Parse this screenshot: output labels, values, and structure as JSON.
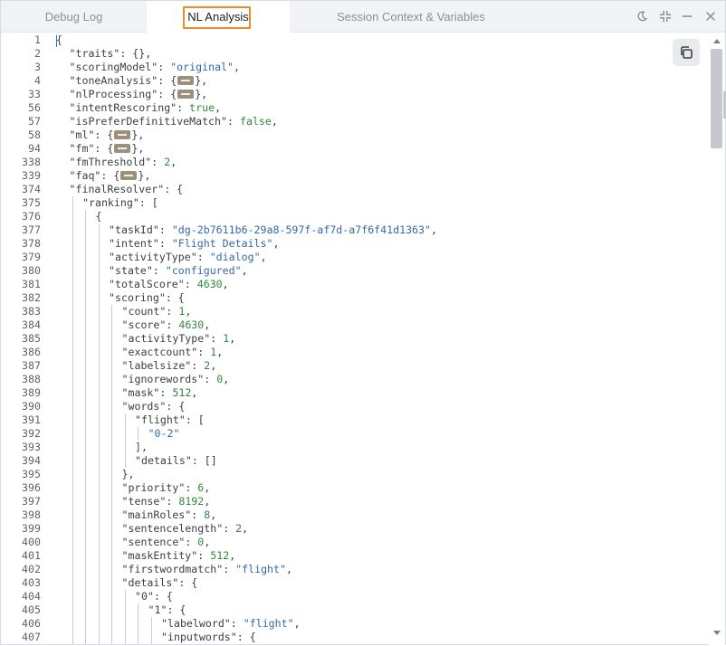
{
  "tabs": [
    {
      "label": "Debug Log",
      "active": false
    },
    {
      "label": "NL Analysis",
      "active": true
    },
    {
      "label": "Session Context & Variables",
      "active": false
    }
  ],
  "window_controls": [
    "moon-icon",
    "collapse-icon",
    "minimize-icon",
    "close-icon"
  ],
  "colors": {
    "highlight": "#f08b2c",
    "string": "#3668a8",
    "number": "#2e8b3a"
  },
  "lines": [
    {
      "n": "1",
      "d": 0,
      "t": [
        [
          "p",
          "{"
        ]
      ]
    },
    {
      "n": "2",
      "d": 1,
      "t": [
        [
          "k",
          "\"traits\""
        ],
        [
          "p",
          ": {},"
        ]
      ]
    },
    {
      "n": "3",
      "d": 1,
      "t": [
        [
          "k",
          "\"scoringModel\""
        ],
        [
          "p",
          ": "
        ],
        [
          "s",
          "\"original\""
        ],
        [
          "p",
          ","
        ]
      ]
    },
    {
      "n": "4",
      "d": 1,
      "t": [
        [
          "k",
          "\"toneAnalysis\""
        ],
        [
          "p",
          ": {"
        ],
        [
          "f",
          ""
        ],
        [
          "p",
          "},"
        ]
      ]
    },
    {
      "n": "33",
      "d": 1,
      "t": [
        [
          "k",
          "\"nlProcessing\""
        ],
        [
          "p",
          ": {"
        ],
        [
          "f",
          ""
        ],
        [
          "p",
          "},"
        ]
      ]
    },
    {
      "n": "56",
      "d": 1,
      "t": [
        [
          "k",
          "\"intentRescoring\""
        ],
        [
          "p",
          ": "
        ],
        [
          "b",
          "true"
        ],
        [
          "p",
          ","
        ]
      ]
    },
    {
      "n": "57",
      "d": 1,
      "t": [
        [
          "k",
          "\"isPreferDefinitiveMatch\""
        ],
        [
          "p",
          ": "
        ],
        [
          "b",
          "false"
        ],
        [
          "p",
          ","
        ]
      ]
    },
    {
      "n": "58",
      "d": 1,
      "t": [
        [
          "k",
          "\"ml\""
        ],
        [
          "p",
          ": {"
        ],
        [
          "f",
          ""
        ],
        [
          "p",
          "},"
        ]
      ]
    },
    {
      "n": "94",
      "d": 1,
      "t": [
        [
          "k",
          "\"fm\""
        ],
        [
          "p",
          ": {"
        ],
        [
          "f",
          ""
        ],
        [
          "p",
          "},"
        ]
      ]
    },
    {
      "n": "338",
      "d": 1,
      "t": [
        [
          "k",
          "\"fmThreshold\""
        ],
        [
          "p",
          ": "
        ],
        [
          "m",
          "2"
        ],
        [
          "p",
          ","
        ]
      ]
    },
    {
      "n": "339",
      "d": 1,
      "t": [
        [
          "k",
          "\"faq\""
        ],
        [
          "p",
          ": {"
        ],
        [
          "f",
          ""
        ],
        [
          "p",
          "},"
        ]
      ]
    },
    {
      "n": "374",
      "d": 1,
      "t": [
        [
          "k",
          "\"finalResolver\""
        ],
        [
          "p",
          ": {"
        ]
      ]
    },
    {
      "n": "375",
      "d": 2,
      "t": [
        [
          "k",
          "\"ranking\""
        ],
        [
          "p",
          ": ["
        ]
      ]
    },
    {
      "n": "376",
      "d": 3,
      "t": [
        [
          "p",
          "{"
        ]
      ]
    },
    {
      "n": "377",
      "d": 4,
      "t": [
        [
          "k",
          "\"taskId\""
        ],
        [
          "p",
          ": "
        ],
        [
          "s",
          "\"dg-2b7611b6-29a8-597f-af7d-a7f6f41d1363\""
        ],
        [
          "p",
          ","
        ]
      ]
    },
    {
      "n": "378",
      "d": 4,
      "t": [
        [
          "k",
          "\"intent\""
        ],
        [
          "p",
          ": "
        ],
        [
          "s",
          "\"Flight Details\""
        ],
        [
          "p",
          ","
        ]
      ]
    },
    {
      "n": "379",
      "d": 4,
      "t": [
        [
          "k",
          "\"activityType\""
        ],
        [
          "p",
          ": "
        ],
        [
          "s",
          "\"dialog\""
        ],
        [
          "p",
          ","
        ]
      ]
    },
    {
      "n": "380",
      "d": 4,
      "t": [
        [
          "k",
          "\"state\""
        ],
        [
          "p",
          ": "
        ],
        [
          "s",
          "\"configured\""
        ],
        [
          "p",
          ","
        ]
      ]
    },
    {
      "n": "381",
      "d": 4,
      "t": [
        [
          "k",
          "\"totalScore\""
        ],
        [
          "p",
          ": "
        ],
        [
          "m",
          "4630"
        ],
        [
          "p",
          ","
        ]
      ]
    },
    {
      "n": "382",
      "d": 4,
      "t": [
        [
          "k",
          "\"scoring\""
        ],
        [
          "p",
          ": {"
        ]
      ]
    },
    {
      "n": "383",
      "d": 5,
      "t": [
        [
          "k",
          "\"count\""
        ],
        [
          "p",
          ": "
        ],
        [
          "m",
          "1"
        ],
        [
          "p",
          ","
        ]
      ]
    },
    {
      "n": "384",
      "d": 5,
      "t": [
        [
          "k",
          "\"score\""
        ],
        [
          "p",
          ": "
        ],
        [
          "m",
          "4630"
        ],
        [
          "p",
          ","
        ]
      ]
    },
    {
      "n": "385",
      "d": 5,
      "t": [
        [
          "k",
          "\"activityType\""
        ],
        [
          "p",
          ": "
        ],
        [
          "m",
          "1"
        ],
        [
          "p",
          ","
        ]
      ]
    },
    {
      "n": "386",
      "d": 5,
      "t": [
        [
          "k",
          "\"exactcount\""
        ],
        [
          "p",
          ": "
        ],
        [
          "m",
          "1"
        ],
        [
          "p",
          ","
        ]
      ]
    },
    {
      "n": "387",
      "d": 5,
      "t": [
        [
          "k",
          "\"labelsize\""
        ],
        [
          "p",
          ": "
        ],
        [
          "m",
          "2"
        ],
        [
          "p",
          ","
        ]
      ]
    },
    {
      "n": "388",
      "d": 5,
      "t": [
        [
          "k",
          "\"ignorewords\""
        ],
        [
          "p",
          ": "
        ],
        [
          "m",
          "0"
        ],
        [
          "p",
          ","
        ]
      ]
    },
    {
      "n": "389",
      "d": 5,
      "t": [
        [
          "k",
          "\"mask\""
        ],
        [
          "p",
          ": "
        ],
        [
          "m",
          "512"
        ],
        [
          "p",
          ","
        ]
      ]
    },
    {
      "n": "390",
      "d": 5,
      "t": [
        [
          "k",
          "\"words\""
        ],
        [
          "p",
          ": {"
        ]
      ]
    },
    {
      "n": "391",
      "d": 6,
      "t": [
        [
          "k",
          "\"flight\""
        ],
        [
          "p",
          ": ["
        ]
      ]
    },
    {
      "n": "392",
      "d": 7,
      "t": [
        [
          "s",
          "\"0-2\""
        ]
      ]
    },
    {
      "n": "393",
      "d": 6,
      "t": [
        [
          "p",
          "],"
        ]
      ]
    },
    {
      "n": "394",
      "d": 6,
      "t": [
        [
          "k",
          "\"details\""
        ],
        [
          "p",
          ": []"
        ]
      ]
    },
    {
      "n": "395",
      "d": 5,
      "t": [
        [
          "p",
          "},"
        ]
      ]
    },
    {
      "n": "396",
      "d": 5,
      "t": [
        [
          "k",
          "\"priority\""
        ],
        [
          "p",
          ": "
        ],
        [
          "m",
          "6"
        ],
        [
          "p",
          ","
        ]
      ]
    },
    {
      "n": "397",
      "d": 5,
      "t": [
        [
          "k",
          "\"tense\""
        ],
        [
          "p",
          ": "
        ],
        [
          "m",
          "8192"
        ],
        [
          "p",
          ","
        ]
      ]
    },
    {
      "n": "398",
      "d": 5,
      "t": [
        [
          "k",
          "\"mainRoles\""
        ],
        [
          "p",
          ": "
        ],
        [
          "m",
          "8"
        ],
        [
          "p",
          ","
        ]
      ]
    },
    {
      "n": "399",
      "d": 5,
      "t": [
        [
          "k",
          "\"sentencelength\""
        ],
        [
          "p",
          ": "
        ],
        [
          "m",
          "2"
        ],
        [
          "p",
          ","
        ]
      ]
    },
    {
      "n": "400",
      "d": 5,
      "t": [
        [
          "k",
          "\"sentence\""
        ],
        [
          "p",
          ": "
        ],
        [
          "m",
          "0"
        ],
        [
          "p",
          ","
        ]
      ]
    },
    {
      "n": "401",
      "d": 5,
      "t": [
        [
          "k",
          "\"maskEntity\""
        ],
        [
          "p",
          ": "
        ],
        [
          "m",
          "512"
        ],
        [
          "p",
          ","
        ]
      ]
    },
    {
      "n": "402",
      "d": 5,
      "t": [
        [
          "k",
          "\"firstwordmatch\""
        ],
        [
          "p",
          ": "
        ],
        [
          "s",
          "\"flight\""
        ],
        [
          "p",
          ","
        ]
      ]
    },
    {
      "n": "403",
      "d": 5,
      "t": [
        [
          "k",
          "\"details\""
        ],
        [
          "p",
          ": {"
        ]
      ]
    },
    {
      "n": "404",
      "d": 6,
      "t": [
        [
          "k",
          "\"0\""
        ],
        [
          "p",
          ": {"
        ]
      ]
    },
    {
      "n": "405",
      "d": 7,
      "t": [
        [
          "k",
          "\"1\""
        ],
        [
          "p",
          ": {"
        ]
      ]
    },
    {
      "n": "406",
      "d": 8,
      "t": [
        [
          "k",
          "\"labelword\""
        ],
        [
          "p",
          ": "
        ],
        [
          "s",
          "\"flight\""
        ],
        [
          "p",
          ","
        ]
      ]
    },
    {
      "n": "407",
      "d": 8,
      "t": [
        [
          "k",
          "\"inputwords\""
        ],
        [
          "p",
          ": {"
        ]
      ]
    }
  ]
}
